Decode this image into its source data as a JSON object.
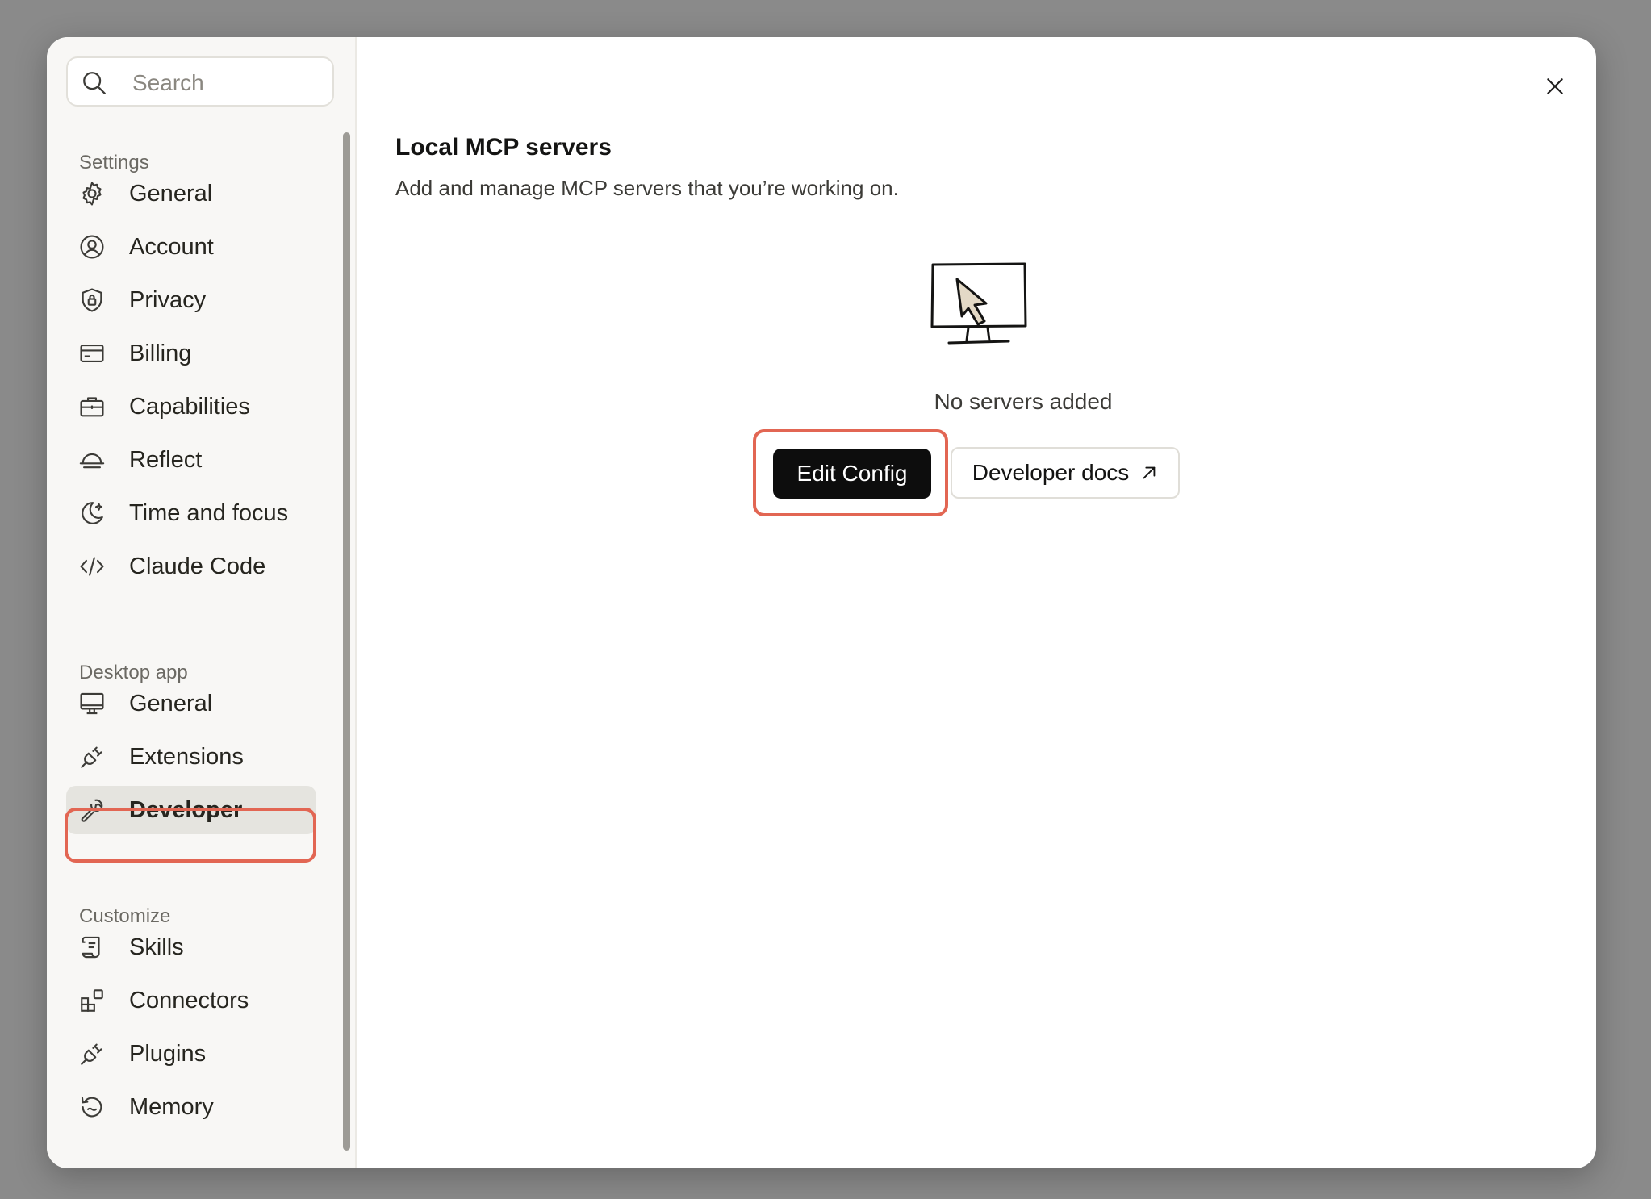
{
  "search": {
    "placeholder": "Search"
  },
  "sidebar": {
    "sections": [
      {
        "label": "Settings",
        "items": [
          "General",
          "Account",
          "Privacy",
          "Billing",
          "Capabilities",
          "Reflect",
          "Time and focus",
          "Claude Code"
        ]
      },
      {
        "label": "Desktop app",
        "items": [
          "General",
          "Extensions",
          "Developer"
        ]
      },
      {
        "label": "Customize",
        "items": [
          "Skills",
          "Connectors",
          "Plugins",
          "Memory"
        ]
      }
    ],
    "active_item": "Developer"
  },
  "main": {
    "title": "Local MCP servers",
    "subtitle": "Add and manage MCP servers that you’re working on.",
    "empty_state": "No servers added",
    "edit_config_label": "Edit Config",
    "developer_docs_label": "Developer docs"
  },
  "icons": {
    "search": "search-icon",
    "close": "close-icon",
    "external_link": "arrow-up-right-icon"
  },
  "colors": {
    "highlight": "#e26653",
    "primary_button": "#0d0d0d"
  }
}
